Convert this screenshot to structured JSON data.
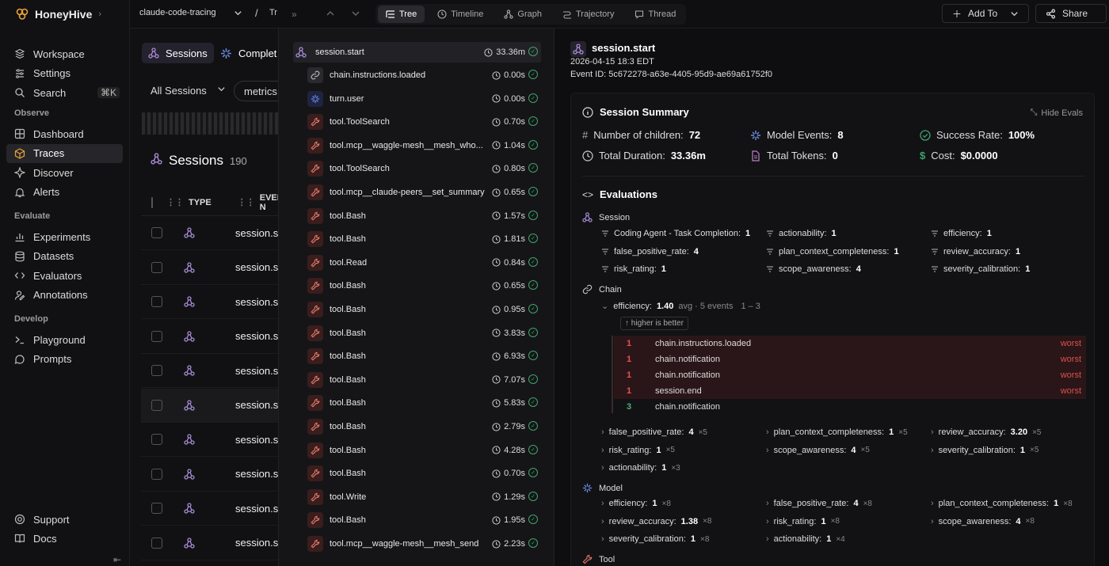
{
  "app": {
    "name": "HoneyHive",
    "accent": "#a98bd6"
  },
  "sidebar": {
    "top": [
      {
        "label": "Workspace",
        "icon": "workspace-icon"
      },
      {
        "label": "Settings",
        "icon": "settings-icon"
      },
      {
        "label": "Search",
        "icon": "search-icon",
        "kbd": "⌘K"
      }
    ],
    "groups": [
      {
        "label": "Observe",
        "items": [
          {
            "label": "Dashboard"
          },
          {
            "label": "Traces",
            "active": true
          },
          {
            "label": "Discover"
          },
          {
            "label": "Alerts"
          }
        ]
      },
      {
        "label": "Evaluate",
        "items": [
          {
            "label": "Experiments"
          },
          {
            "label": "Datasets"
          },
          {
            "label": "Evaluators"
          },
          {
            "label": "Annotations"
          }
        ]
      },
      {
        "label": "Develop",
        "items": [
          {
            "label": "Playground"
          },
          {
            "label": "Prompts"
          }
        ]
      }
    ],
    "bottom": [
      {
        "label": "Support"
      },
      {
        "label": "Docs"
      }
    ]
  },
  "topbar": {
    "project": "claude-code-tracing",
    "crumb": "Tr",
    "tabs": [
      {
        "label": "Tree",
        "active": true
      },
      {
        "label": "Timeline"
      },
      {
        "label": "Graph"
      },
      {
        "label": "Trajectory"
      },
      {
        "label": "Thread"
      }
    ],
    "add_to": "Add To",
    "share": "Share"
  },
  "sessions": {
    "seg_active": "Sessions",
    "seg_other": "Complet",
    "filter": "All Sessions",
    "metrics_chip": "metrics",
    "title": "Sessions",
    "count": "190",
    "col_type": "TYPE",
    "col_event": "EVENT N",
    "rows": [
      "session.s",
      "session.s",
      "session.s",
      "session.s",
      "session.s",
      "session.s",
      "session.s",
      "session.s",
      "session.s",
      "session.s"
    ]
  },
  "tree": {
    "root": {
      "name": "session.start",
      "dur": "33.36m"
    },
    "children": [
      {
        "name": "chain.instructions.loaded",
        "dur": "0.00s",
        "kind": "chain"
      },
      {
        "name": "turn.user",
        "dur": "0.00s",
        "kind": "model"
      },
      {
        "name": "tool.ToolSearch",
        "dur": "0.70s",
        "kind": "tool"
      },
      {
        "name": "tool.mcp__waggle-mesh__mesh_who...",
        "dur": "1.04s",
        "kind": "tool"
      },
      {
        "name": "tool.ToolSearch",
        "dur": "0.80s",
        "kind": "tool"
      },
      {
        "name": "tool.mcp__claude-peers__set_summary",
        "dur": "0.65s",
        "kind": "tool"
      },
      {
        "name": "tool.Bash",
        "dur": "1.57s",
        "kind": "tool"
      },
      {
        "name": "tool.Bash",
        "dur": "1.81s",
        "kind": "tool"
      },
      {
        "name": "tool.Read",
        "dur": "0.84s",
        "kind": "tool"
      },
      {
        "name": "tool.Bash",
        "dur": "0.65s",
        "kind": "tool"
      },
      {
        "name": "tool.Bash",
        "dur": "0.95s",
        "kind": "tool"
      },
      {
        "name": "tool.Bash",
        "dur": "3.83s",
        "kind": "tool"
      },
      {
        "name": "tool.Bash",
        "dur": "6.93s",
        "kind": "tool"
      },
      {
        "name": "tool.Bash",
        "dur": "7.07s",
        "kind": "tool"
      },
      {
        "name": "tool.Bash",
        "dur": "5.83s",
        "kind": "tool"
      },
      {
        "name": "tool.Bash",
        "dur": "2.79s",
        "kind": "tool"
      },
      {
        "name": "tool.Bash",
        "dur": "4.28s",
        "kind": "tool"
      },
      {
        "name": "tool.Bash",
        "dur": "0.70s",
        "kind": "tool"
      },
      {
        "name": "tool.Write",
        "dur": "1.29s",
        "kind": "tool"
      },
      {
        "name": "tool.Bash",
        "dur": "1.95s",
        "kind": "tool"
      },
      {
        "name": "tool.mcp__waggle-mesh__mesh_send",
        "dur": "2.23s",
        "kind": "tool"
      }
    ]
  },
  "detail": {
    "title": "session.start",
    "date": "2026-04-15 18:3 EDT",
    "event_id": "Event ID: 5c672278-a63e-4405-95d9-ae69a61752f0",
    "summary_title": "Session Summary",
    "hide_evals": "Hide Evals",
    "summary": {
      "children_label": "Number of children:",
      "children": "72",
      "model_events_label": "Model Events:",
      "model_events": "8",
      "success_label": "Success Rate:",
      "success": "100%",
      "duration_label": "Total Duration:",
      "duration": "33.36m",
      "tokens_label": "Total Tokens:",
      "tokens": "0",
      "cost_label": "Cost:",
      "cost": "$0.0000"
    },
    "evaluations_title": "Evaluations",
    "session": {
      "label": "Session",
      "items": [
        {
          "k": "Coding Agent - Task Completion:",
          "v": "1"
        },
        {
          "k": "actionability:",
          "v": "1"
        },
        {
          "k": "efficiency:",
          "v": "1"
        },
        {
          "k": "false_positive_rate:",
          "v": "4"
        },
        {
          "k": "plan_context_completeness:",
          "v": "1"
        },
        {
          "k": "review_accuracy:",
          "v": "1"
        },
        {
          "k": "risk_rating:",
          "v": "1"
        },
        {
          "k": "scope_awareness:",
          "v": "4"
        },
        {
          "k": "severity_calibration:",
          "v": "1"
        }
      ]
    },
    "chain": {
      "label": "Chain",
      "eff_label": "efficiency:",
      "eff_val": "1.40",
      "eff_meta": "avg · 5 events",
      "eff_range": "1 – 3",
      "hint": "higher is better",
      "worst_rows": [
        {
          "n": "1",
          "e": "chain.instructions.loaded",
          "w": "worst",
          "bad": true
        },
        {
          "n": "1",
          "e": "chain.notification",
          "w": "worst",
          "bad": true
        },
        {
          "n": "1",
          "e": "chain.notification",
          "w": "worst",
          "bad": true
        },
        {
          "n": "1",
          "e": "session.end",
          "w": "worst",
          "bad": true
        },
        {
          "n": "3",
          "e": "chain.notification",
          "w": "",
          "bad": false
        }
      ],
      "items": [
        {
          "k": "false_positive_rate:",
          "v": "4",
          "x": "×5"
        },
        {
          "k": "plan_context_completeness:",
          "v": "1",
          "x": "×5"
        },
        {
          "k": "review_accuracy:",
          "v": "3.20",
          "x": "×5"
        },
        {
          "k": "risk_rating:",
          "v": "1",
          "x": "×5"
        },
        {
          "k": "scope_awareness:",
          "v": "4",
          "x": "×5"
        },
        {
          "k": "severity_calibration:",
          "v": "1",
          "x": "×5"
        },
        {
          "k": "actionability:",
          "v": "1",
          "x": "×3"
        }
      ]
    },
    "model": {
      "label": "Model",
      "items": [
        {
          "k": "efficiency:",
          "v": "1",
          "x": "×8"
        },
        {
          "k": "false_positive_rate:",
          "v": "4",
          "x": "×8"
        },
        {
          "k": "plan_context_completeness:",
          "v": "1",
          "x": "×8"
        },
        {
          "k": "review_accuracy:",
          "v": "1.38",
          "x": "×8"
        },
        {
          "k": "risk_rating:",
          "v": "1",
          "x": "×8"
        },
        {
          "k": "scope_awareness:",
          "v": "4",
          "x": "×8"
        },
        {
          "k": "severity_calibration:",
          "v": "1",
          "x": "×8"
        },
        {
          "k": "actionability:",
          "v": "1",
          "x": "×4"
        }
      ]
    },
    "tool_label": "Tool"
  }
}
